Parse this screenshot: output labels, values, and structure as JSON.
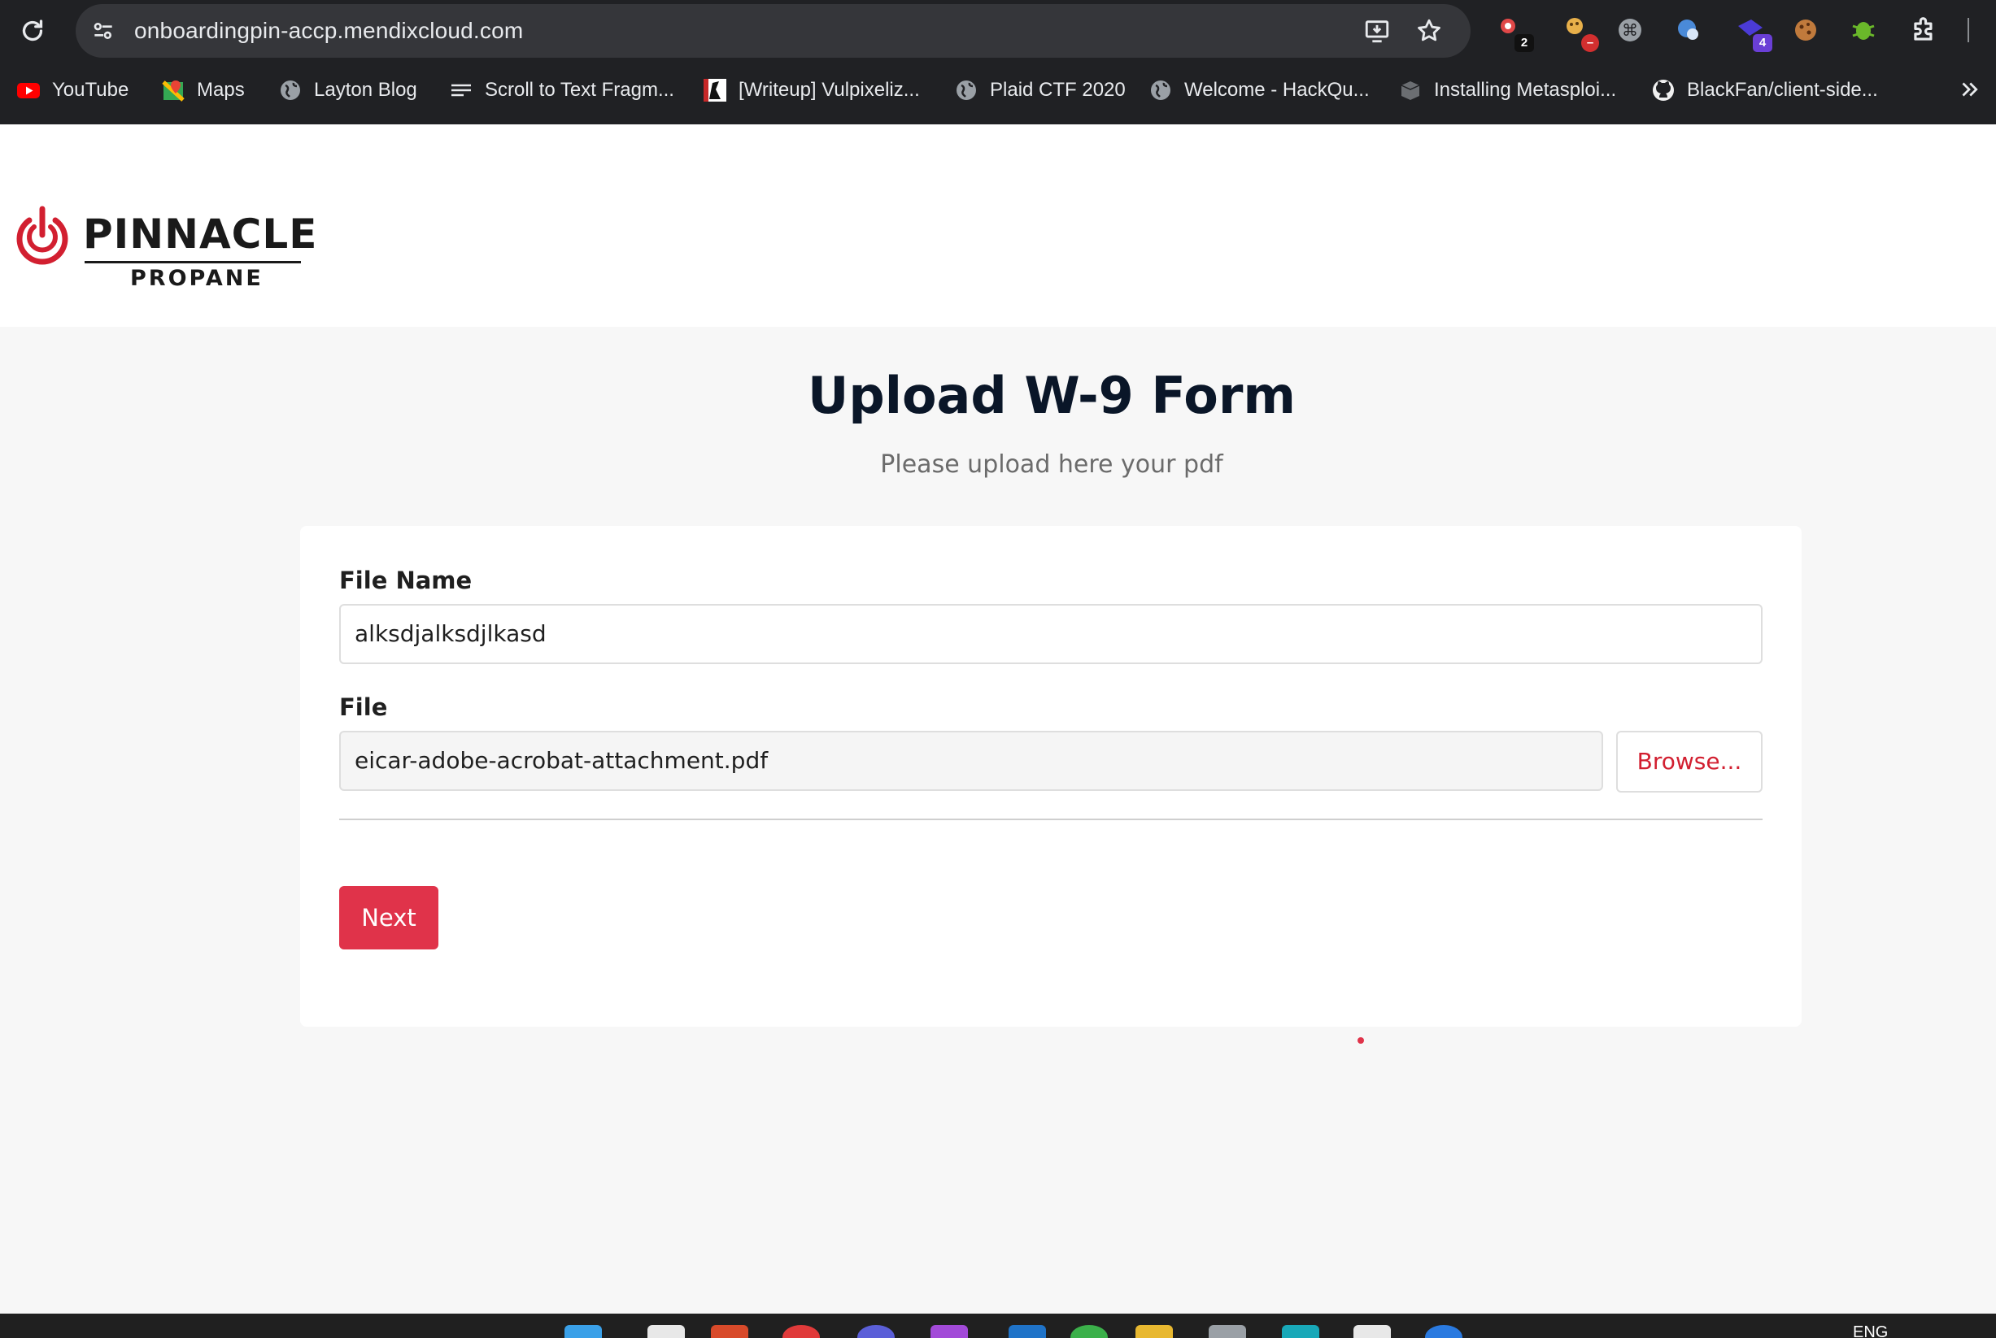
{
  "browser": {
    "url": "onboardingpin-accp.mendixcloud.com",
    "extensions": [
      {
        "name": "extension-1",
        "badge": "2",
        "badge_color": "#111111"
      },
      {
        "name": "extension-2",
        "badge": "",
        "badge_color": "#d32f2f"
      },
      {
        "name": "extension-3",
        "badge": ""
      },
      {
        "name": "extension-4",
        "badge": ""
      },
      {
        "name": "extension-5",
        "badge": "4",
        "badge_color": "#6a3fd6"
      },
      {
        "name": "cookie-extension",
        "badge": ""
      },
      {
        "name": "bug-extension",
        "badge": ""
      }
    ],
    "bookmarks": [
      {
        "label": "YouTube",
        "icon": "youtube-icon"
      },
      {
        "label": "Maps",
        "icon": "maps-icon"
      },
      {
        "label": "Layton Blog",
        "icon": "globe-icon"
      },
      {
        "label": "Scroll to Text Fragm...",
        "icon": "text-lines-icon"
      },
      {
        "label": "[Writeup] Vulpixeliz...",
        "icon": "writeup-icon"
      },
      {
        "label": "Plaid CTF 2020",
        "icon": "globe-icon"
      },
      {
        "label": "Welcome - HackQu...",
        "icon": "globe-icon"
      },
      {
        "label": "Installing Metasploi...",
        "icon": "box-icon"
      },
      {
        "label": "BlackFan/client-side...",
        "icon": "github-icon"
      }
    ]
  },
  "brand": {
    "name": "PINNACLE",
    "sub": "PROPANE",
    "color": "#d21f30"
  },
  "page": {
    "title": "Upload W-9 Form",
    "subtitle": "Please upload here your pdf"
  },
  "form": {
    "file_name_label": "File Name",
    "file_name_value": "alksdjalksdjlkasd",
    "file_label": "File",
    "file_value": "eicar-adobe-acrobat-attachment.pdf",
    "browse_label": "Browse...",
    "next_label": "Next"
  },
  "taskbar": {
    "language": "ENG"
  }
}
